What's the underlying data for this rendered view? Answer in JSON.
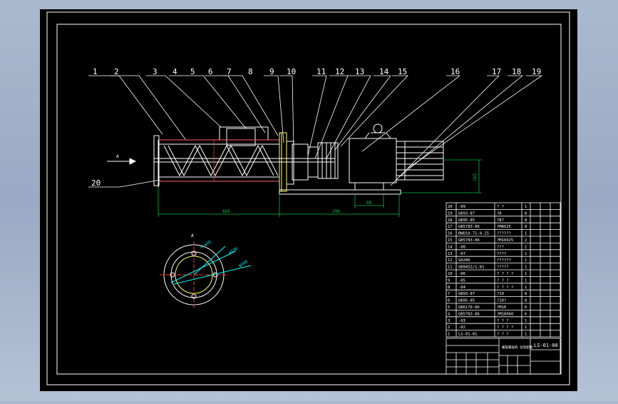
{
  "canvas": {
    "background": "#000000",
    "frame_color": "#ffffff",
    "geometry_color": "#ffffff",
    "dimension_color": "#00c040",
    "hidden_color": "#ff3030",
    "leader_color": "#ffffff",
    "motor_color": "#ffffff",
    "highlight_color": "#ffff66"
  },
  "balloons": [
    "1",
    "2",
    "3",
    "4",
    "5",
    "6",
    "7",
    "8",
    "9",
    "10",
    "11",
    "12",
    "13",
    "14",
    "15",
    "16",
    "17",
    "18",
    "19"
  ],
  "balloon_20": "20",
  "section_mark": "A",
  "arrow_label": "A",
  "dimensions": {
    "overall_length": "860",
    "drive_length": "390",
    "base_span": "80",
    "height": "165"
  },
  "section_view_labels": [
    "4-φ16",
    "φ130",
    "φ160"
  ],
  "title_block": {
    "drawing_number": "LS-01-00",
    "title_note": "螺旋输送机 总装配图"
  },
  "parts_list": [
    {
      "no": "20",
      "code": "-09",
      "name": "? ?",
      "qty": "1"
    },
    {
      "no": "19",
      "code": "GB93-87",
      "name": "?8",
      "qty": "8"
    },
    {
      "no": "18",
      "code": "GB95-85",
      "name": "?8?",
      "qty": "8"
    },
    {
      "no": "17",
      "code": "GB5783-86",
      "name": "?M8X25",
      "qty": "8"
    },
    {
      "no": "16",
      "code": "BWD10-71-0.25",
      "name": "??????",
      "qty": "1"
    },
    {
      "no": "15",
      "code": "GB5783-86",
      "name": "?M10X25",
      "qty": "2"
    },
    {
      "no": "14",
      "code": "-08",
      "name": "???",
      "qty": "2"
    },
    {
      "no": "13",
      "code": "-07",
      "name": "????",
      "qty": "1"
    },
    {
      "no": "12",
      "code": "SA206",
      "name": "??????",
      "qty": "1"
    },
    {
      "no": "11",
      "code": "GB9452/1-81",
      "name": "?????",
      "qty": "1"
    },
    {
      "no": "10",
      "code": "-06",
      "name": "? ? ? ?",
      "qty": "1"
    },
    {
      "no": "9",
      "code": "-05",
      "name": "? ? ?",
      "qty": "1"
    },
    {
      "no": "8",
      "code": "-04",
      "name": "? ? ? ?",
      "qty": "1"
    },
    {
      "no": "7",
      "code": "GB93-87",
      "name": "?10",
      "qty": "8"
    },
    {
      "no": "6",
      "code": "GB95-85",
      "name": "?10?",
      "qty": "8"
    },
    {
      "no": "5",
      "code": "GB6170-86",
      "name": "?M10",
      "qty": "6"
    },
    {
      "no": "4",
      "code": "GB5783-86",
      "name": "?M10X60",
      "qty": "6"
    },
    {
      "no": "3",
      "code": "-03",
      "name": "? ? ?",
      "qty": "1"
    },
    {
      "no": "2",
      "code": "-02",
      "name": "? ? ? ?",
      "qty": "1"
    },
    {
      "no": "1",
      "code": "LS-01-01",
      "name": "? ? ?",
      "qty": "1"
    }
  ]
}
